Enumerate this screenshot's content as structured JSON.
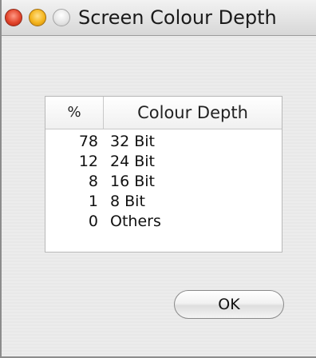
{
  "window": {
    "title": "Screen Colour Depth"
  },
  "titlebar": {
    "buttons": [
      {
        "name": "close",
        "color": "#e2452c"
      },
      {
        "name": "minimize",
        "color": "#f4b41c"
      },
      {
        "name": "zoom",
        "color": "#e4e4e4"
      }
    ]
  },
  "table": {
    "columns": [
      "%",
      "Colour Depth"
    ],
    "rows": [
      {
        "percent": "78",
        "depth": "32 Bit"
      },
      {
        "percent": "12",
        "depth": "24 Bit"
      },
      {
        "percent": "8",
        "depth": "16 Bit"
      },
      {
        "percent": "1",
        "depth": "8 Bit"
      },
      {
        "percent": "0",
        "depth": "Others"
      }
    ]
  },
  "buttons": {
    "ok_label": "OK"
  }
}
